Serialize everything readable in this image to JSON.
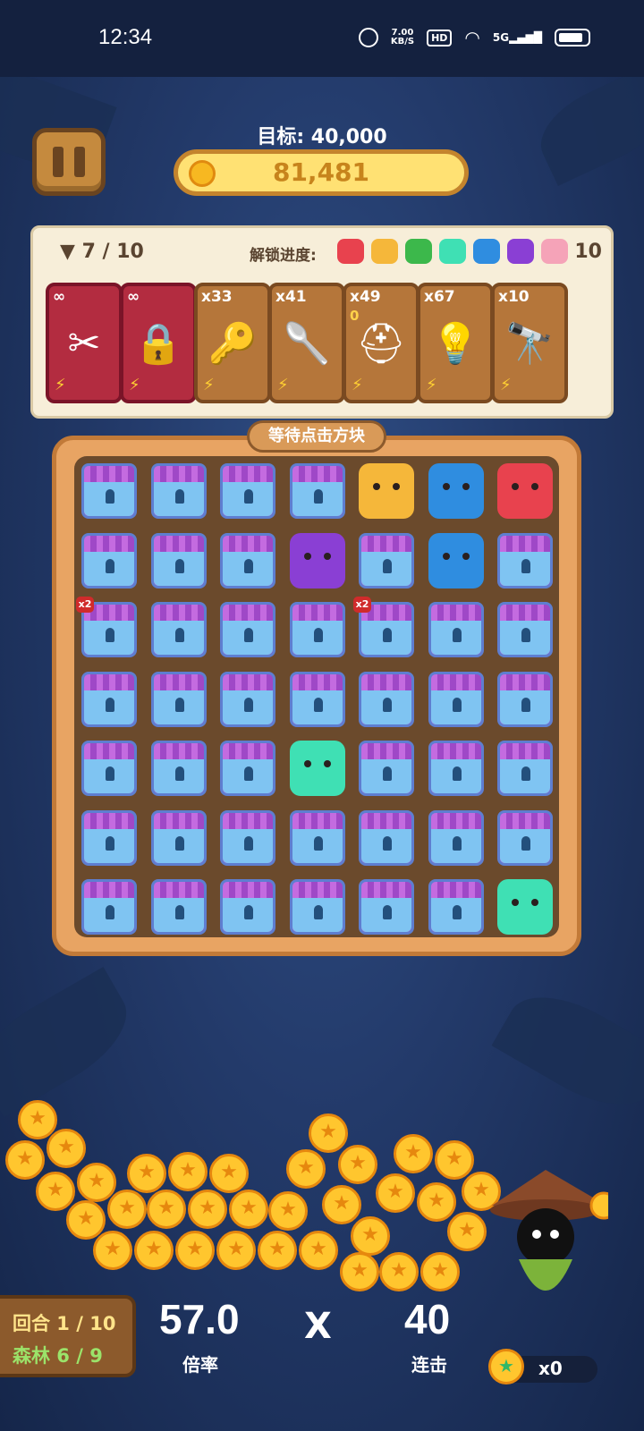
{
  "status_bar": {
    "time": "12:34",
    "net_speed": "7.00",
    "net_unit": "KB/S",
    "hd": "HD",
    "signal": "5G"
  },
  "header": {
    "goal": "目标: 40,000",
    "score": "81,481"
  },
  "panel": {
    "progress": "▼ 7 / 10",
    "unlock_label": "解锁进度:",
    "unlock_count": "10",
    "unlock_animals": [
      {
        "name": "red-cat",
        "color": "#e8424e"
      },
      {
        "name": "yellow-dog",
        "color": "#f5b73a"
      },
      {
        "name": "green-frog",
        "color": "#3cb84b"
      },
      {
        "name": "teal-cat",
        "color": "#3fe0b4"
      },
      {
        "name": "blue-bird",
        "color": "#2f8de0"
      },
      {
        "name": "purple-hippo",
        "color": "#8a3fd4"
      },
      {
        "name": "pink-pig",
        "color": "#f5a3b8"
      }
    ],
    "items": [
      {
        "name": "scissors",
        "count": "∞",
        "icon": "✂",
        "variant": "red"
      },
      {
        "name": "safe",
        "count": "∞",
        "icon": "🔒",
        "variant": "red"
      },
      {
        "name": "key",
        "count": "x33",
        "icon": "🔑",
        "variant": "wood"
      },
      {
        "name": "spoon",
        "count": "x41",
        "icon": "🥄",
        "variant": "wood"
      },
      {
        "name": "helmet",
        "count": "x49",
        "sub": "0",
        "icon": "⛑",
        "variant": "wood"
      },
      {
        "name": "bulb",
        "count": "x67",
        "icon": "💡",
        "variant": "wood"
      },
      {
        "name": "telescope",
        "count": "x10",
        "icon": "🔭",
        "variant": "wood"
      }
    ]
  },
  "board": {
    "tag": "等待点击方块",
    "colors": {
      "yellow-dog": "#f5b73a",
      "blue-bird": "#2f8de0",
      "red-cat": "#e8424e",
      "purple-hippo": "#8a3fd4",
      "teal-cat": "#3fe0b4"
    },
    "grid": [
      [
        "chest",
        "chest",
        "chest",
        "chest",
        "yellow-dog",
        "blue-bird",
        "red-cat"
      ],
      [
        "chest",
        "chest",
        "chest",
        "purple-hippo",
        "chest",
        "blue-bird",
        "chest"
      ],
      [
        "chest",
        "chest",
        "chest",
        "chest",
        "chest",
        "chest",
        "chest"
      ],
      [
        "chest",
        "chest",
        "chest",
        "chest",
        "chest",
        "chest",
        "chest"
      ],
      [
        "chest",
        "chest",
        "chest",
        "teal-cat",
        "chest",
        "chest",
        "chest"
      ],
      [
        "chest",
        "chest",
        "chest",
        "chest",
        "chest",
        "chest",
        "chest"
      ],
      [
        "chest",
        "chest",
        "chest",
        "chest",
        "chest",
        "chest",
        "teal-cat"
      ]
    ],
    "badges": [
      {
        "row": 2,
        "col": 0,
        "text": "x2"
      },
      {
        "row": 2,
        "col": 4,
        "text": "x2"
      }
    ]
  },
  "footer": {
    "round": "回合 1 / 10",
    "forest": "森林 6 / 9",
    "multiplier": "57.0",
    "multiplier_label": "倍率",
    "x": "X",
    "combo": "40",
    "combo_label": "连击",
    "gems": "x0"
  }
}
